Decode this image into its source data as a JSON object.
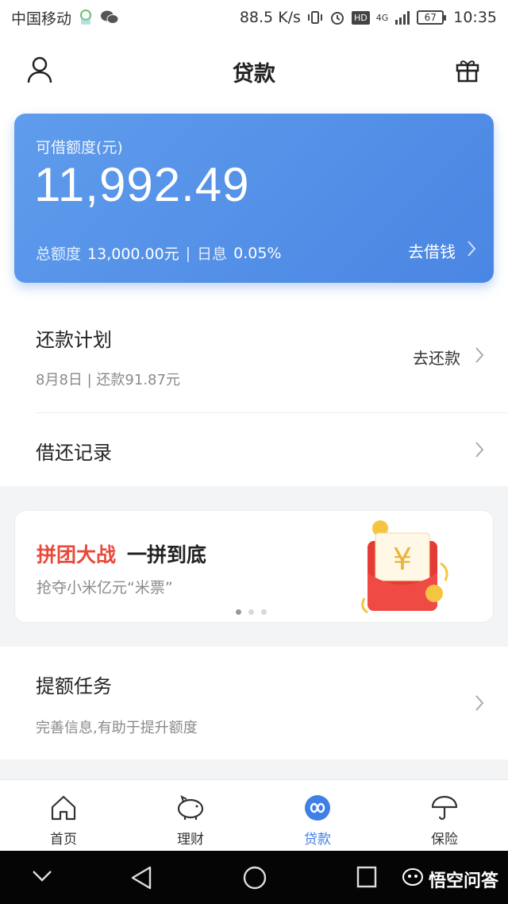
{
  "status_bar": {
    "carrier": "中国移动",
    "speed": "88.5 K/s",
    "hd": "HD",
    "network": "4G",
    "battery": "67",
    "time": "10:35"
  },
  "header": {
    "title": "贷款",
    "left_icon": "user-icon",
    "right_icon": "gift-icon"
  },
  "credit_card": {
    "label": "可借额度(元)",
    "amount": "11,992.49",
    "total_label": "总额度",
    "total_value": "13,000.00元",
    "separator": "|",
    "rate_label": "日息",
    "rate_value": "0.05%",
    "action": "去借钱"
  },
  "repayment": {
    "title": "还款计划",
    "subtitle": "8月8日 | 还款91.87元",
    "action": "去还款"
  },
  "records": {
    "title": "借还记录"
  },
  "banner": {
    "title_red": "拼团大战",
    "title_dark": "一拼到底",
    "subtitle": "抢夺小米亿元“米票”",
    "yuan_symbol": "¥",
    "page_count": 3,
    "active_page": 1
  },
  "limit_task": {
    "title": "提额任务",
    "subtitle": "完善信息,有助于提升额度"
  },
  "tabbar": {
    "tabs": [
      {
        "label": "首页",
        "icon": "home-icon",
        "active": false
      },
      {
        "label": "理财",
        "icon": "piggy-bank-icon",
        "active": false
      },
      {
        "label": "贷款",
        "icon": "loan-icon",
        "active": true
      },
      {
        "label": "保险",
        "icon": "umbrella-icon",
        "active": false
      }
    ]
  },
  "system_nav": {
    "watermark": "悟空问答"
  },
  "colors": {
    "accent": "#3f7fe6",
    "card_gradient_start": "#5f9cec",
    "card_gradient_end": "#4a86e3",
    "banner_red": "#e8493a"
  }
}
